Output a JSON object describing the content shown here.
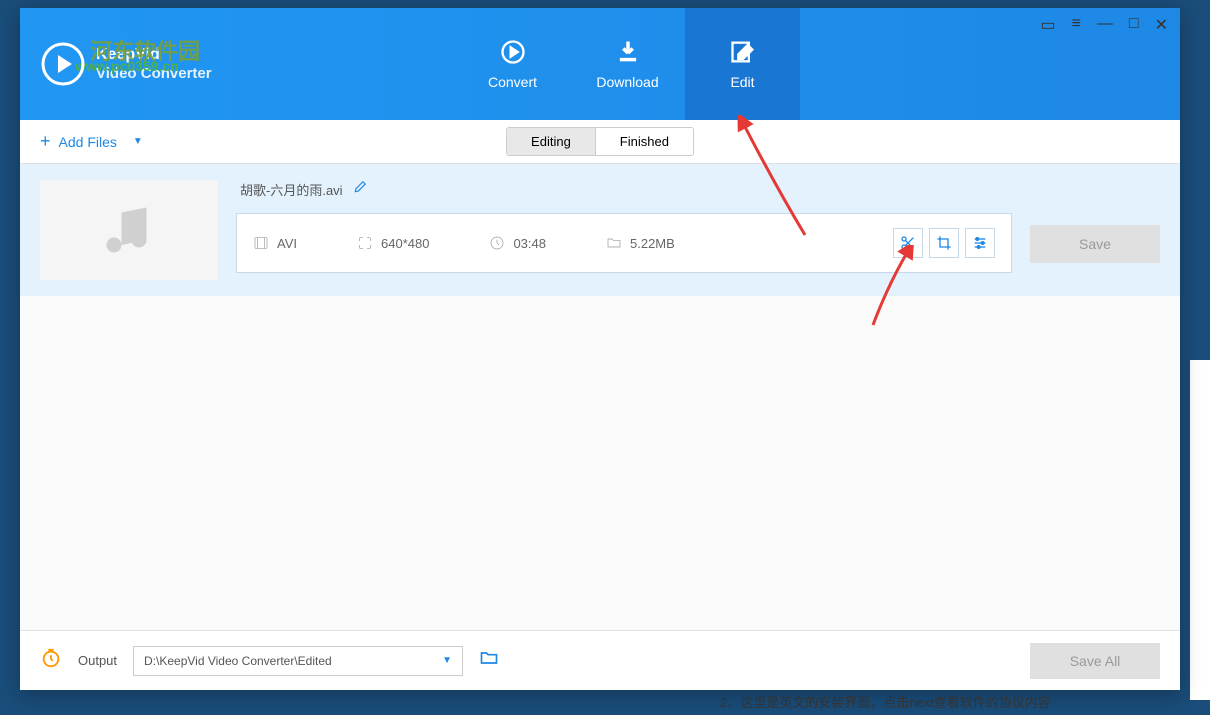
{
  "app": {
    "name": "KeepVid",
    "subtitle": "Video Converter"
  },
  "watermark": {
    "site_cn": "河东软件园",
    "url": "www.pc0359.cn"
  },
  "nav": {
    "convert": "Convert",
    "download": "Download",
    "edit": "Edit"
  },
  "toolbar": {
    "add_files": "Add Files"
  },
  "subtabs": {
    "editing": "Editing",
    "finished": "Finished"
  },
  "file": {
    "name": "胡歌-六月的雨.avi",
    "format": "AVI",
    "resolution": "640*480",
    "duration": "03:48",
    "size": "5.22MB",
    "save_label": "Save"
  },
  "footer": {
    "output_label": "Output",
    "output_path": "D:\\KeepVid Video Converter\\Edited",
    "save_all": "Save All"
  },
  "bg_text": "2、这里是英文的安装界面，点击next查看软件的协议内容"
}
